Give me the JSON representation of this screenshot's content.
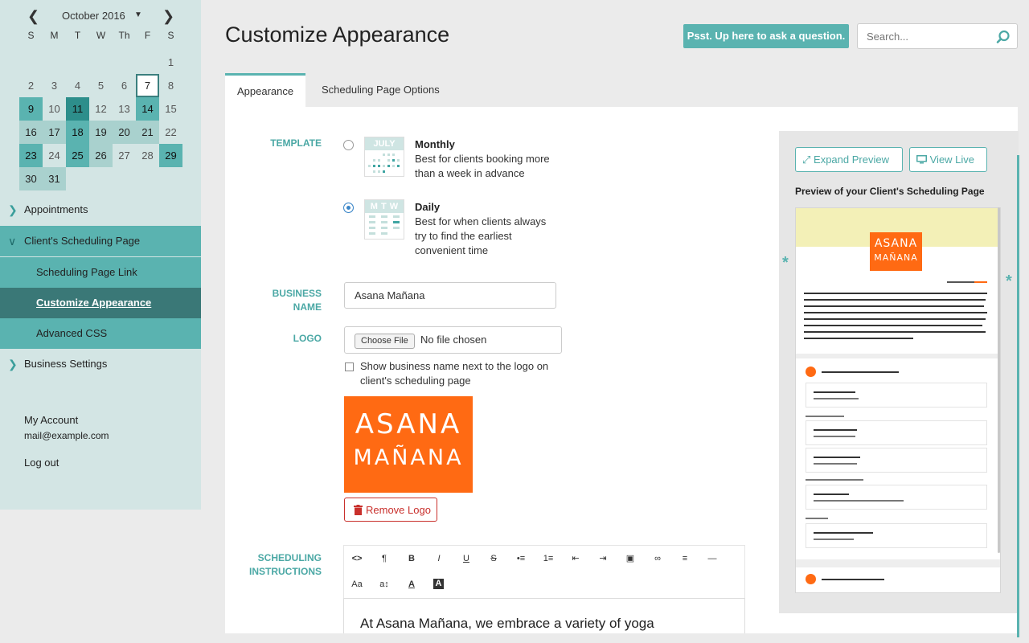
{
  "calendar": {
    "month_label": "October 2016",
    "weekdays": [
      "S",
      "M",
      "T",
      "W",
      "Th",
      "F",
      "S"
    ],
    "days": [
      {
        "n": "",
        "s": "e"
      },
      {
        "n": "",
        "s": "e"
      },
      {
        "n": "",
        "s": "e"
      },
      {
        "n": "",
        "s": "e"
      },
      {
        "n": "",
        "s": "e"
      },
      {
        "n": "",
        "s": "e"
      },
      {
        "n": "1",
        "s": ""
      },
      {
        "n": "2",
        "s": ""
      },
      {
        "n": "3",
        "s": ""
      },
      {
        "n": "4",
        "s": ""
      },
      {
        "n": "5",
        "s": ""
      },
      {
        "n": "6",
        "s": ""
      },
      {
        "n": "7",
        "s": "today"
      },
      {
        "n": "8",
        "s": ""
      },
      {
        "n": "9",
        "s": "m"
      },
      {
        "n": "10",
        "s": ""
      },
      {
        "n": "11",
        "s": "d"
      },
      {
        "n": "12",
        "s": ""
      },
      {
        "n": "13",
        "s": ""
      },
      {
        "n": "14",
        "s": "m"
      },
      {
        "n": "15",
        "s": ""
      },
      {
        "n": "16",
        "s": "l"
      },
      {
        "n": "17",
        "s": "l"
      },
      {
        "n": "18",
        "s": "m"
      },
      {
        "n": "19",
        "s": "l"
      },
      {
        "n": "20",
        "s": "l"
      },
      {
        "n": "21",
        "s": "l"
      },
      {
        "n": "22",
        "s": ""
      },
      {
        "n": "23",
        "s": "m"
      },
      {
        "n": "24",
        "s": ""
      },
      {
        "n": "25",
        "s": "m"
      },
      {
        "n": "26",
        "s": "l"
      },
      {
        "n": "27",
        "s": ""
      },
      {
        "n": "28",
        "s": ""
      },
      {
        "n": "29",
        "s": "m"
      },
      {
        "n": "30",
        "s": "l"
      },
      {
        "n": "31",
        "s": "l"
      }
    ]
  },
  "nav": {
    "appointments": "Appointments",
    "scheduling_page": "Client's Scheduling Page",
    "link": "Scheduling Page Link",
    "customize": "Customize Appearance",
    "advanced_css": "Advanced CSS",
    "business_settings": "Business Settings",
    "my_account": "My Account",
    "email": "mail@example.com",
    "logout": "Log out"
  },
  "header": {
    "title": "Customize Appearance",
    "ask_button": "Psst. Up here to ask a question.",
    "search_placeholder": "Search..."
  },
  "tabs": {
    "appearance": "Appearance",
    "options": "Scheduling Page Options"
  },
  "form": {
    "template_label": "TEMPLATE",
    "monthly": {
      "title": "Monthly",
      "desc_line1": "Best for clients booking more",
      "desc_line2": "than a week in advance",
      "icon_text": "JULY",
      "selected": false
    },
    "daily": {
      "title": "Daily",
      "desc_line1": "Best for when clients always",
      "desc_line2": "try to find the earliest",
      "desc_line3": "convenient time",
      "icon_text": "M T W",
      "selected": true
    },
    "business_name_label_1": "BUSINESS",
    "business_name_label_2": "NAME",
    "business_name_value": "Asana Mañana",
    "logo_label": "LOGO",
    "choose_file": "Choose File",
    "no_file": "No file chosen",
    "show_name_line1": "Show business name next to the logo on",
    "show_name_line2": "client's scheduling page",
    "logo_text_1": "ASANA",
    "logo_text_2": "MAÑANA",
    "remove_logo": "Remove Logo",
    "instructions_label_1": "SCHEDULING",
    "instructions_label_2": "INSTRUCTIONS",
    "editor_text": "At Asana Mañana, we embrace a variety of yoga",
    "toolbar_row1": [
      "<>",
      "¶",
      "B",
      "I",
      "U",
      "S",
      "•≡",
      "1≡",
      "⇤",
      "⇥",
      "▣",
      "∞",
      "≡",
      "—"
    ],
    "toolbar_row2": [
      "Aa",
      "a↕",
      "A",
      "A"
    ]
  },
  "preview": {
    "expand": "Expand Preview",
    "view_live": "View Live",
    "caption": "Preview of your Client's Scheduling Page",
    "logo_text_1": "ASANA",
    "logo_text_2": "MAÑANA",
    "star": "*"
  },
  "colors": {
    "accent": "#5ab3b0",
    "logo": "#ff6a13",
    "danger": "#c9302c",
    "sidebar": "#d3e5e4"
  }
}
